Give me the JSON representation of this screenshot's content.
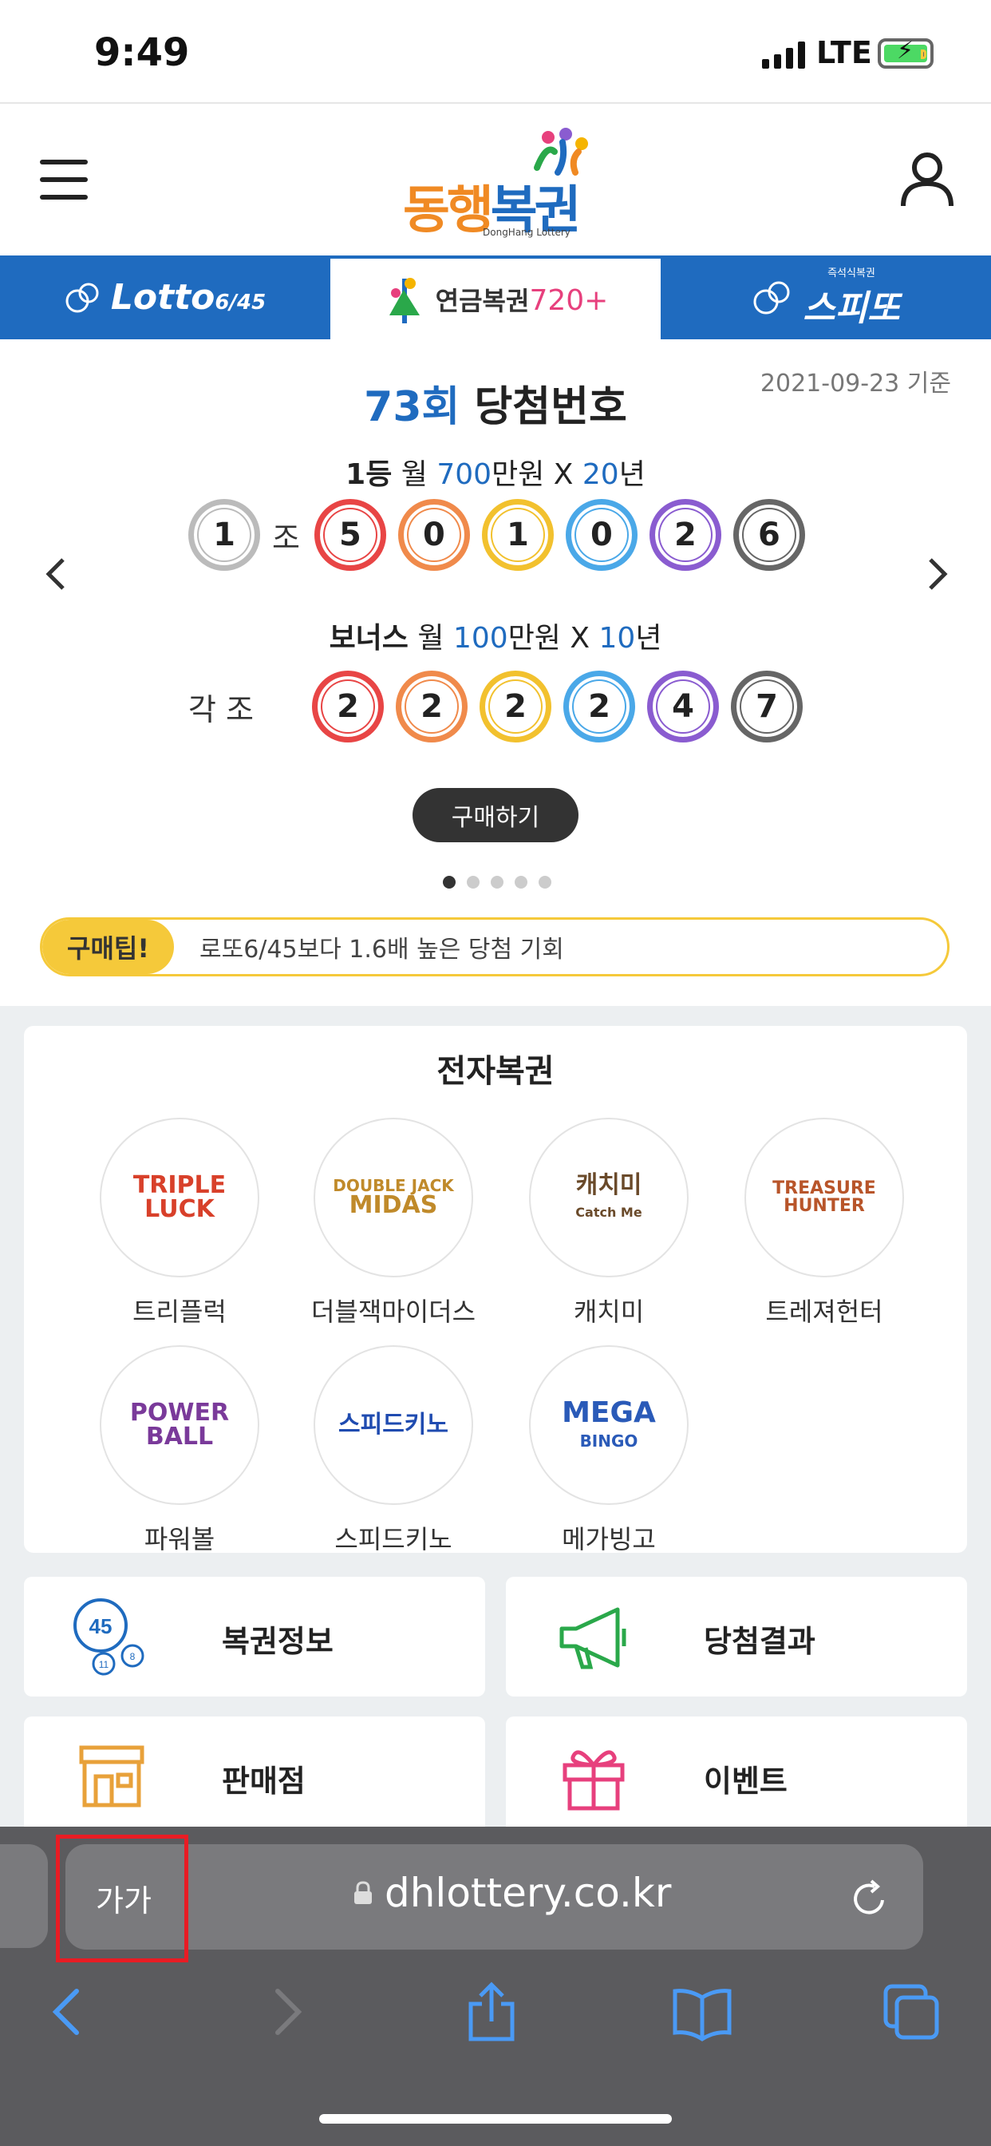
{
  "status_bar": {
    "time": "9:49",
    "network": "LTE",
    "battery_state": "charging"
  },
  "header": {
    "menu_icon": "hamburger-menu-icon",
    "logo_part1": "동행",
    "logo_part2": "복권",
    "logo_sub": "DongHang Lottery",
    "user_icon": "user-icon"
  },
  "tabs": [
    {
      "label": "Lotto",
      "suffix": "6/45"
    },
    {
      "label": "연금복권",
      "suffix": "720+"
    },
    {
      "pre": "즉석식복권",
      "label": "스피또"
    }
  ],
  "draw": {
    "date": "2021-09-23 기준",
    "round": "73회",
    "title": "당첨번호",
    "first_prize": {
      "rank": "1등",
      "w1": "월",
      "amount": "700",
      "unit": "만원 X",
      "years": "20",
      "year_unit": "년"
    },
    "first_group": "1",
    "group_label": "조",
    "first_numbers": [
      "5",
      "0",
      "1",
      "0",
      "2",
      "6"
    ],
    "bonus_prize": {
      "rank": "보너스",
      "w1": "월",
      "amount": "100",
      "unit": "만원 X",
      "years": "10",
      "year_unit": "년"
    },
    "bonus_label": "각 조",
    "bonus_numbers": [
      "2",
      "2",
      "2",
      "2",
      "4",
      "7"
    ],
    "buy_label": "구매하기",
    "slide_count": 5,
    "active_slide": 1,
    "ball_colors": [
      "#e84545",
      "#f08a4b",
      "#f2c12e",
      "#4aa8e8",
      "#8a5cd0",
      "#666666"
    ],
    "group_ball_color": "#bbbbbb"
  },
  "tip": {
    "badge": "구매팁!",
    "text": "로또6/45보다 1.6배 높은 당첨 기회"
  },
  "e_lottery": {
    "title": "전자복권",
    "games": [
      {
        "name": "트리플럭",
        "logo_line1": "TRIPLE",
        "logo_line2": "LUCK",
        "color": "#d8402a"
      },
      {
        "name": "더블잭마이더스",
        "logo_line1": "DOUBLE JACK",
        "logo_line2": "MIDAS",
        "color": "#c08a2a"
      },
      {
        "name": "캐치미",
        "logo_line1": "캐치미",
        "logo_line2": "Catch Me",
        "color": "#6a4a2a"
      },
      {
        "name": "트레져헌터",
        "logo_line1": "TREASURE",
        "logo_line2": "HUNTER",
        "color": "#b8552a"
      },
      {
        "name": "파워볼",
        "logo_line1": "POWER",
        "logo_line2": "BALL",
        "color": "#7a3a9a"
      },
      {
        "name": "스피드키노",
        "logo_line1": "스피드키노",
        "logo_line2": "",
        "color": "#1f4bb0"
      },
      {
        "name": "메가빙고",
        "logo_line1": "MEGA",
        "logo_line2": "BINGO",
        "color": "#2a5ab8"
      }
    ]
  },
  "menu_tiles": [
    {
      "label": "복권정보",
      "icon": "lottery-balls-icon",
      "ball_main": "45",
      "ball_a": "11",
      "ball_b": "8"
    },
    {
      "label": "당첨결과",
      "icon": "megaphone-icon"
    },
    {
      "label": "판매점",
      "icon": "store-icon"
    },
    {
      "label": "이벤트",
      "icon": "gift-icon"
    }
  ],
  "browser": {
    "text_size_label": "가가",
    "url": "dhlottery.co.kr",
    "icons": [
      "back-icon",
      "forward-icon",
      "share-icon",
      "bookmarks-icon",
      "tabs-icon"
    ]
  }
}
